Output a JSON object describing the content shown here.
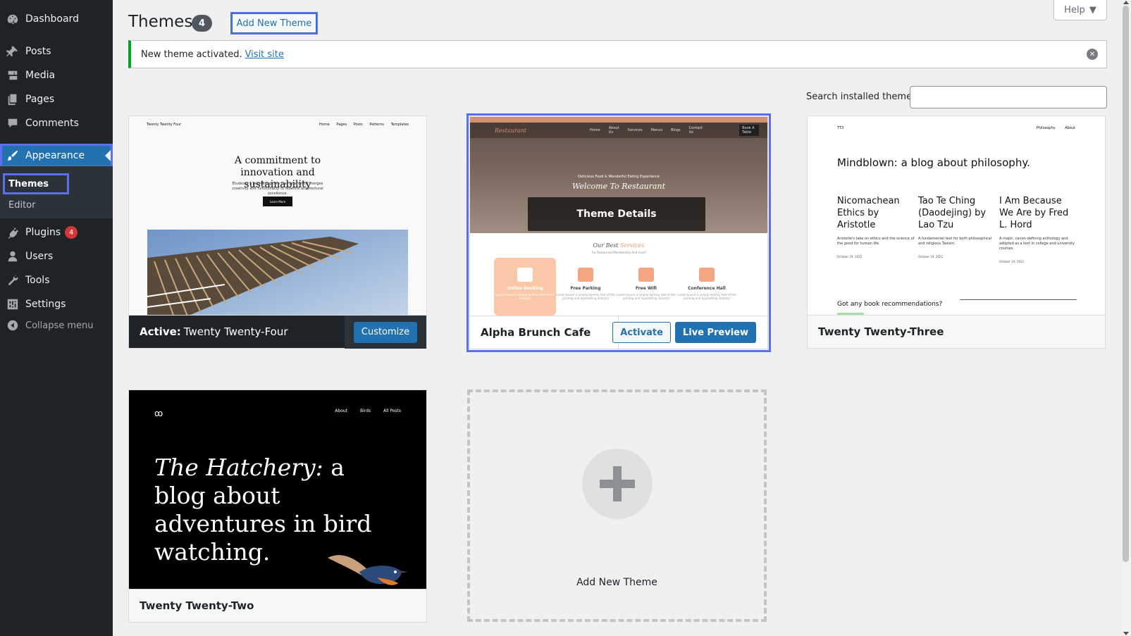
{
  "sidebar": {
    "items": [
      {
        "label": "Dashboard",
        "icon": "dashboard-icon"
      },
      {
        "label": "Posts",
        "icon": "pin-icon"
      },
      {
        "label": "Media",
        "icon": "media-icon"
      },
      {
        "label": "Pages",
        "icon": "pages-icon"
      },
      {
        "label": "Comments",
        "icon": "comment-icon"
      },
      {
        "label": "Appearance",
        "icon": "brush-icon"
      },
      {
        "label": "Plugins",
        "icon": "plug-icon",
        "badge": "4"
      },
      {
        "label": "Users",
        "icon": "user-icon"
      },
      {
        "label": "Tools",
        "icon": "wrench-icon"
      },
      {
        "label": "Settings",
        "icon": "settings-icon"
      }
    ],
    "submenu": {
      "themes": "Themes",
      "editor": "Editor"
    },
    "collapse": "Collapse menu"
  },
  "header": {
    "title": "Themes",
    "count": "4",
    "add_new": "Add New Theme",
    "help": "Help"
  },
  "notice": {
    "text": "New theme activated.",
    "link": "Visit site"
  },
  "search": {
    "label": "Search installed themes",
    "value": ""
  },
  "themes": {
    "tt4": {
      "active_prefix": "Active:",
      "name": "Twenty Twenty-Four",
      "customize": "Customize",
      "preview": {
        "site": "Twenty Twenty Four",
        "nav": [
          "Home",
          "Pages",
          "Posts",
          "Patterns",
          "Templates"
        ],
        "headline": "A commitment to innovation and sustainability",
        "sub": "Études is a pioneering firm that seamlessly merges creativity and functionality to redefine architectural excellence.",
        "button": "Learn More"
      }
    },
    "alpha": {
      "name": "Alpha Brunch Cafe",
      "activate": "Activate",
      "live_preview": "Live Preview",
      "details": "Theme Details",
      "preview": {
        "logo": "Restaurant",
        "nav": [
          "Home",
          "About Us",
          "Services",
          "Menus",
          "Blogs",
          "Contact Us"
        ],
        "book": "Book A Table",
        "hero_sub": "Delicious Food & Wonderful Eating Experience",
        "hero_title": "Welcome To Restaurant",
        "services_title_a": "Our Best",
        "services_title_b": "Services",
        "services_sub": "For Restaurant  Membership And Court",
        "services": [
          {
            "label": "Online Booking",
            "txt": "Lorem Ipsum is simply dummy text of the printing"
          },
          {
            "label": "Free Parking",
            "txt": "Lorem Ipsum is simply dummy text of the printing and typesetting industry"
          },
          {
            "label": "Free Wifi",
            "txt": "Lorem Ipsum is simply dummy text of the printing and typesetting industry"
          },
          {
            "label": "Conference Hall",
            "txt": "Lorem Ipsum is simply dummy text of the printing and typesetting industry"
          }
        ]
      }
    },
    "tt3": {
      "name": "Twenty Twenty-Three",
      "preview": {
        "site": "TT3",
        "nav": [
          "Philosophy",
          "About"
        ],
        "headline": "Mindblown: a blog about philosophy.",
        "posts": [
          {
            "title": "Nicomachean Ethics by Aristotle",
            "desc": "Aristotle's take on ethics and the science of the good for human life.",
            "date": "October 19, 2022"
          },
          {
            "title": "Tao Te Ching (Daodejing) by Lao Tzu",
            "desc": "A fundamental text for both philosophical and religious Taoism.",
            "date": "October 19, 2022"
          },
          {
            "title": "I Am Because We Are by Fred L. Hord",
            "desc": "A major, canon-defining anthology and adopted as a text in college and university courses.",
            "date": "October 19, 2022"
          }
        ],
        "reco": "Got any book recommendations?"
      }
    },
    "tt2": {
      "name": "Twenty Twenty-Two",
      "preview": {
        "logo": "ꝏ",
        "nav": [
          "About",
          "Birds",
          "All Posts"
        ],
        "headline_italic": "The Hatchery:",
        "headline_rest": " a blog about adventures in bird watching."
      }
    }
  },
  "add_new_card": {
    "label": "Add New Theme"
  },
  "colors": {
    "accent": "#2271b1",
    "highlight_outline": "#5b6ff0",
    "sidebar_bg": "#1d2327",
    "notice_green": "#00a32a",
    "badge_red": "#d63638"
  }
}
